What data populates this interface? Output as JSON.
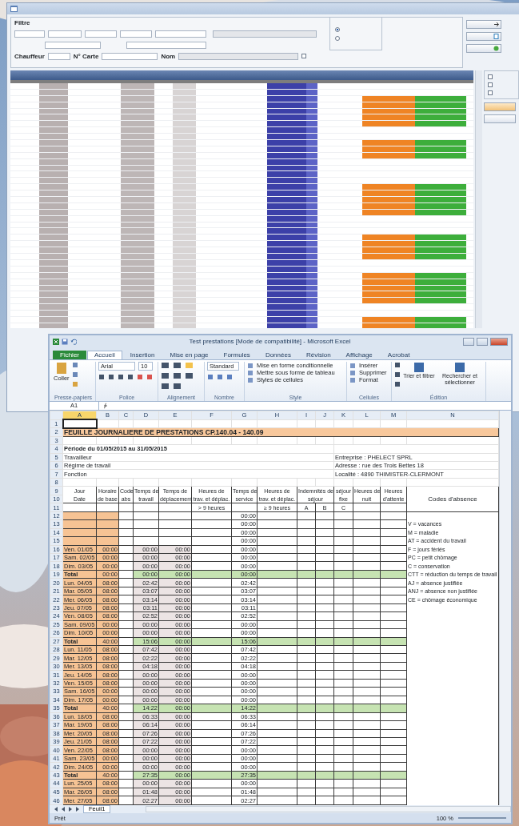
{
  "app": {
    "filter": {
      "title": "Filtre",
      "driver_label": "Chauffeur",
      "card_label": "N° Carte",
      "name_label": "Nom",
      "show_check": {
        "checked": false
      }
    },
    "radios": [
      {
        "selected": true
      },
      {
        "selected": false
      }
    ],
    "side_checks": [
      {
        "checked": false
      },
      {
        "checked": false
      },
      {
        "checked": false
      }
    ],
    "grid": {
      "rows": [
        {
          "highlight": false
        },
        {
          "highlight": false
        },
        {
          "highlight": true
        },
        {
          "highlight": true
        },
        {
          "highlight": true
        },
        {
          "highlight": true
        },
        {
          "highlight": true
        },
        {
          "highlight": false
        },
        {
          "highlight": false
        },
        {
          "highlight": true
        },
        {
          "highlight": true
        },
        {
          "highlight": true
        },
        {
          "highlight": false
        },
        {
          "highlight": false
        },
        {
          "highlight": false
        },
        {
          "highlight": false
        },
        {
          "highlight": true
        },
        {
          "highlight": true
        },
        {
          "highlight": true
        },
        {
          "highlight": true
        },
        {
          "highlight": true
        },
        {
          "highlight": false
        },
        {
          "highlight": false
        },
        {
          "highlight": false
        },
        {
          "highlight": true
        },
        {
          "highlight": true
        },
        {
          "highlight": true
        },
        {
          "highlight": true
        },
        {
          "highlight": false
        },
        {
          "highlight": false
        },
        {
          "highlight": true
        },
        {
          "highlight": true
        },
        {
          "highlight": true
        },
        {
          "highlight": true
        },
        {
          "highlight": true
        },
        {
          "highlight": false
        },
        {
          "highlight": false
        },
        {
          "highlight": true
        },
        {
          "highlight": true
        }
      ]
    }
  },
  "excel": {
    "title": "Test prestations  [Mode de compatibilité] - Microsoft Excel",
    "tabs": [
      {
        "label": "Fichier",
        "selected": false,
        "kind": "file"
      },
      {
        "label": "Accueil",
        "selected": true,
        "kind": "tab"
      },
      {
        "label": "Insertion",
        "selected": false,
        "kind": "tab"
      },
      {
        "label": "Mise en page",
        "selected": false,
        "kind": "tab"
      },
      {
        "label": "Formules",
        "selected": false,
        "kind": "tab"
      },
      {
        "label": "Données",
        "selected": false,
        "kind": "tab"
      },
      {
        "label": "Révision",
        "selected": false,
        "kind": "tab"
      },
      {
        "label": "Affichage",
        "selected": false,
        "kind": "tab"
      },
      {
        "label": "Acrobat",
        "selected": false,
        "kind": "tab"
      }
    ],
    "ribbon": {
      "paste": "Coller",
      "font": "Arial",
      "size": "10",
      "number_format": "Standard",
      "styles": [
        "Mise en forme conditionnelle",
        "Mettre sous forme de tableau",
        "Styles de cellules"
      ],
      "cells": [
        "Insérer",
        "Supprimer",
        "Format"
      ],
      "sort": "Trier et filtrer",
      "find": "Rechercher et sélectionner",
      "groups": [
        "Presse-papiers",
        "Police",
        "Alignement",
        "Nombre",
        "Style",
        "Cellules",
        "Édition"
      ]
    },
    "name_box": "A1",
    "columns": [
      {
        "label": "A",
        "selected": true
      },
      {
        "label": "B",
        "selected": false
      },
      {
        "label": "C",
        "selected": false
      },
      {
        "label": "D",
        "selected": false
      },
      {
        "label": "E",
        "selected": false
      },
      {
        "label": "F",
        "selected": false
      },
      {
        "label": "G",
        "selected": false
      },
      {
        "label": "H",
        "selected": false
      },
      {
        "label": "I",
        "selected": false
      },
      {
        "label": "J",
        "selected": false
      },
      {
        "label": "K",
        "selected": false
      },
      {
        "label": "L",
        "selected": false
      },
      {
        "label": "M",
        "selected": false
      },
      {
        "label": "N",
        "selected": false
      }
    ],
    "row_numbers": [
      "1",
      "2",
      "3",
      "4",
      "5",
      "6",
      "7",
      "8",
      "9",
      "10",
      "11",
      "12",
      "13",
      "14",
      "15",
      "16",
      "17",
      "18",
      "19",
      "20",
      "21",
      "22",
      "23",
      "24",
      "25",
      "26",
      "27",
      "28",
      "29",
      "30",
      "31",
      "32",
      "33",
      "34",
      "35",
      "36",
      "37",
      "38",
      "39",
      "40",
      "41",
      "42",
      "43",
      "44",
      "45",
      "46"
    ],
    "sheet_title": "FEUILLE JOURNALIERE DE PRESTATIONS CP.140.04 - 140.09",
    "info_left": [
      "Période du 01/05/2015 au 31/05/2015",
      "Travailleur",
      "Régime de travail",
      "Fonction"
    ],
    "info_right": [
      "Entreprise : PHELECT SPRL",
      "Adresse : rue des Trois Bettes 18",
      "Localité : 4890  THIMISTER-CLERMONT"
    ],
    "header": [
      {
        "top": "Jour",
        "bottom": "Date"
      },
      {
        "top": "Horaire",
        "bottom": "de base"
      },
      {
        "top": "Code",
        "bottom": "abs"
      },
      {
        "top": "Temps de",
        "bottom": "travail"
      },
      {
        "top": "Temps de",
        "bottom": "déplacement"
      },
      {
        "top": "Heures de",
        "bottom": "trav. et déplac.",
        "sub": "> 9 heures"
      },
      {
        "top": "Temps de",
        "bottom": "service"
      },
      {
        "top": "Heures de",
        "bottom": "trav. et déplac.",
        "sub": "≥ 9 heures"
      },
      {
        "kind": "group",
        "top": "Indemnités de",
        "bottom": "séjour",
        "subs": [
          "A",
          "B"
        ]
      },
      {
        "top": "séjour",
        "bottom": "fixe",
        "sub": "C"
      },
      {
        "top": "Heures de",
        "bottom": "nuit"
      },
      {
        "top": "Heures",
        "bottom": "d'attente"
      }
    ],
    "absence_title": "Codes d'absence",
    "absence_codes": [
      "V = vacances",
      "M = maladie",
      "AT = accident du travail",
      "F = jours fériés",
      "PC = petit chômage",
      "C = conservation",
      "CTT = réduction du temps de travail",
      "AJ = absence justifiée",
      "ANJ = absence non justifiée",
      "CE = chômage économique"
    ],
    "rows": [
      {
        "kind": "blank",
        "service": "00:00"
      },
      {
        "kind": "blank",
        "service": "00:00"
      },
      {
        "kind": "blank",
        "service": "00:00"
      },
      {
        "kind": "blank",
        "service": "00:00"
      },
      {
        "kind": "day",
        "day": "Ven. 01/05",
        "base": "00:00",
        "work": "00:00",
        "travel": "00:00",
        "service": "00:00"
      },
      {
        "kind": "day",
        "day": "Sam. 02/05",
        "base": "00:00",
        "work": "00:00",
        "travel": "00:00",
        "service": "00:00"
      },
      {
        "kind": "day",
        "day": "Dim. 03/05",
        "base": "00:00",
        "work": "00:00",
        "travel": "00:00",
        "service": "00:00"
      },
      {
        "kind": "total",
        "day": "Total",
        "base": "00:00",
        "work": "00:00",
        "travel": "00:00",
        "service": "00:00"
      },
      {
        "kind": "day",
        "day": "Lun. 04/05",
        "base": "08:00",
        "work": "02:42",
        "travel": "00:00",
        "service": "02:42"
      },
      {
        "kind": "day",
        "day": "Mar. 05/05",
        "base": "08:00",
        "work": "03:07",
        "travel": "00:00",
        "service": "03:07"
      },
      {
        "kind": "day",
        "day": "Mer. 06/05",
        "base": "08:00",
        "work": "03:14",
        "travel": "00:00",
        "service": "03:14"
      },
      {
        "kind": "day",
        "day": "Jeu. 07/05",
        "base": "08:00",
        "work": "03:11",
        "travel": "00:00",
        "service": "03:11"
      },
      {
        "kind": "day",
        "day": "Ven. 08/05",
        "base": "08:00",
        "work": "02:52",
        "travel": "00:00",
        "service": "02:52"
      },
      {
        "kind": "day",
        "day": "Sam. 09/05",
        "base": "00:00",
        "work": "00:00",
        "travel": "00:00",
        "service": "00:00"
      },
      {
        "kind": "day",
        "day": "Dim. 10/05",
        "base": "00:00",
        "work": "00:00",
        "travel": "00:00",
        "service": "00:00"
      },
      {
        "kind": "total",
        "day": "Total",
        "base": "40:00",
        "work": "15:06",
        "travel": "00:00",
        "service": "15:06"
      },
      {
        "kind": "day",
        "day": "Lun. 11/05",
        "base": "08:00",
        "work": "07:42",
        "travel": "00:00",
        "service": "07:42"
      },
      {
        "kind": "day",
        "day": "Mar. 12/05",
        "base": "08:00",
        "work": "02:22",
        "travel": "00:00",
        "service": "02:22"
      },
      {
        "kind": "day",
        "day": "Mer. 13/05",
        "base": "08:00",
        "work": "04:18",
        "travel": "00:00",
        "service": "04:18"
      },
      {
        "kind": "day",
        "day": "Jeu. 14/05",
        "base": "08:00",
        "work": "00:00",
        "travel": "00:00",
        "service": "00:00"
      },
      {
        "kind": "day",
        "day": "Ven. 15/05",
        "base": "08:00",
        "work": "00:00",
        "travel": "00:00",
        "service": "00:00"
      },
      {
        "kind": "day",
        "day": "Sam. 16/05",
        "base": "00:00",
        "work": "00:00",
        "travel": "00:00",
        "service": "00:00"
      },
      {
        "kind": "day",
        "day": "Dim. 17/05",
        "base": "00:00",
        "work": "00:00",
        "travel": "00:00",
        "service": "00:00"
      },
      {
        "kind": "total",
        "day": "Total",
        "base": "40:00",
        "work": "14:22",
        "travel": "00:00",
        "service": "14:22"
      },
      {
        "kind": "day",
        "day": "Lun. 18/05",
        "base": "08:00",
        "work": "06:33",
        "travel": "00:00",
        "service": "06:33"
      },
      {
        "kind": "day",
        "day": "Mar. 19/05",
        "base": "08:00",
        "work": "06:14",
        "travel": "00:00",
        "service": "06:14"
      },
      {
        "kind": "day",
        "day": "Mer. 20/05",
        "base": "08:00",
        "work": "07:26",
        "travel": "00:00",
        "service": "07:26"
      },
      {
        "kind": "day",
        "day": "Jeu. 21/05",
        "base": "08:00",
        "work": "07:22",
        "travel": "00:00",
        "service": "07:22"
      },
      {
        "kind": "day",
        "day": "Ven. 22/05",
        "base": "08:00",
        "work": "00:00",
        "travel": "00:00",
        "service": "00:00"
      },
      {
        "kind": "day",
        "day": "Sam. 23/05",
        "base": "00:00",
        "work": "00:00",
        "travel": "00:00",
        "service": "00:00"
      },
      {
        "kind": "day",
        "day": "Dim. 24/05",
        "base": "00:00",
        "work": "00:00",
        "travel": "00:00",
        "service": "00:00"
      },
      {
        "kind": "total",
        "day": "Total",
        "base": "40:00",
        "work": "27:35",
        "travel": "00:00",
        "service": "27:35"
      },
      {
        "kind": "day",
        "day": "Lun. 25/05",
        "base": "08:00",
        "work": "00:00",
        "travel": "00:00",
        "service": "00:00"
      },
      {
        "kind": "day",
        "day": "Mar. 26/05",
        "base": "08:00",
        "work": "01:48",
        "travel": "00:00",
        "service": "01:48"
      },
      {
        "kind": "day",
        "day": "Mer. 27/05",
        "base": "08:00",
        "work": "02:27",
        "travel": "00:00",
        "service": "02:27"
      }
    ],
    "sheet_tabs": [
      {
        "label": "Feuil1",
        "selected": true
      }
    ],
    "status": "Prêt",
    "zoom": "100 %"
  }
}
